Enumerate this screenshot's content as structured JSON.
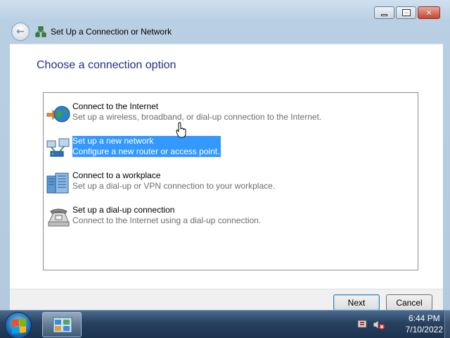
{
  "window": {
    "title": "Set Up a Connection or Network",
    "controls": {
      "minimize_icon": "minimize-icon",
      "maximize_icon": "maximize-icon",
      "close_icon": "close-icon",
      "close_glyph": "✕"
    }
  },
  "back_glyph": "←",
  "heading": "Choose a connection option",
  "options": [
    {
      "title": "Connect to the Internet",
      "description": "Set up a wireless, broadband, or dial-up connection to the Internet.",
      "icon": "globe-connection-icon",
      "selected": false
    },
    {
      "title": "Set up a new network",
      "description": "Configure a new router or access point.",
      "icon": "new-network-icon",
      "selected": true
    },
    {
      "title": "Connect to a workplace",
      "description": "Set up a dial-up or VPN connection to your workplace.",
      "icon": "workplace-icon",
      "selected": false
    },
    {
      "title": "Set up a dial-up connection",
      "description": "Connect to the Internet using a dial-up connection.",
      "icon": "dialup-phone-icon",
      "selected": false
    }
  ],
  "buttons": {
    "next": "Next",
    "cancel": "Cancel"
  },
  "taskbar": {
    "time": "6:44 PM",
    "date": "7/10/2022"
  },
  "colors": {
    "selection": "#3399ff",
    "heading": "#1e3287",
    "taskbar": "#27415f"
  }
}
